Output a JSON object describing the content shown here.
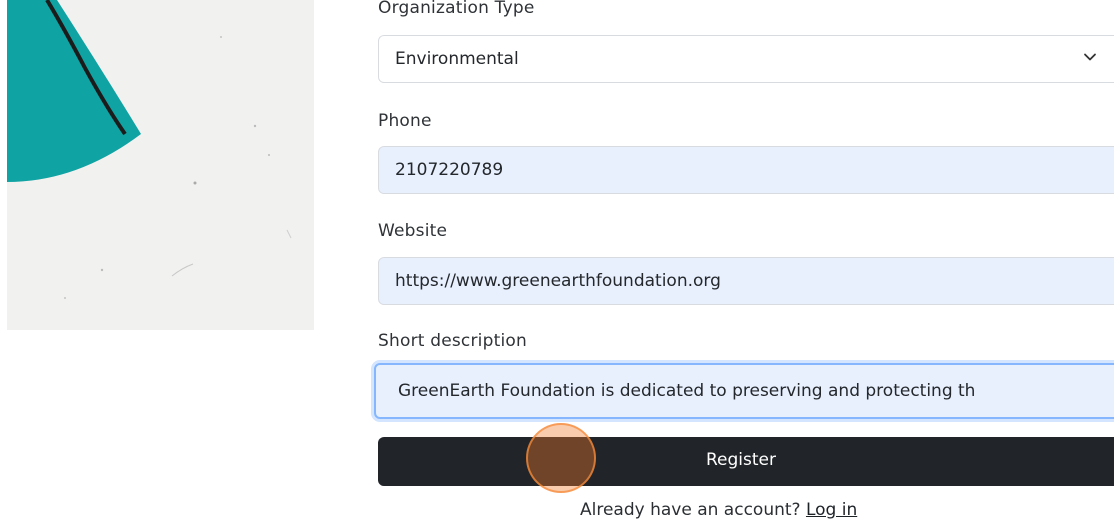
{
  "form": {
    "org_type": {
      "label": "Organization Type",
      "value": "Environmental"
    },
    "phone": {
      "label": "Phone",
      "value": "2107220789"
    },
    "website": {
      "label": "Website",
      "value": "https://www.greenearthfoundation.org"
    },
    "description": {
      "label": "Short description",
      "value": "GreenEarth Foundation is dedicated to preserving and protecting th"
    },
    "register_label": "Register",
    "account_prompt": "Already have an account?",
    "login_label": "Log in"
  },
  "colors": {
    "accent_teal": "#0fa3a3",
    "button_dark": "#212529",
    "autofill_bg": "#e8f0fe",
    "click_marker": "#f07a28"
  },
  "icons": {
    "select_chevron": "chevron-down-icon"
  }
}
